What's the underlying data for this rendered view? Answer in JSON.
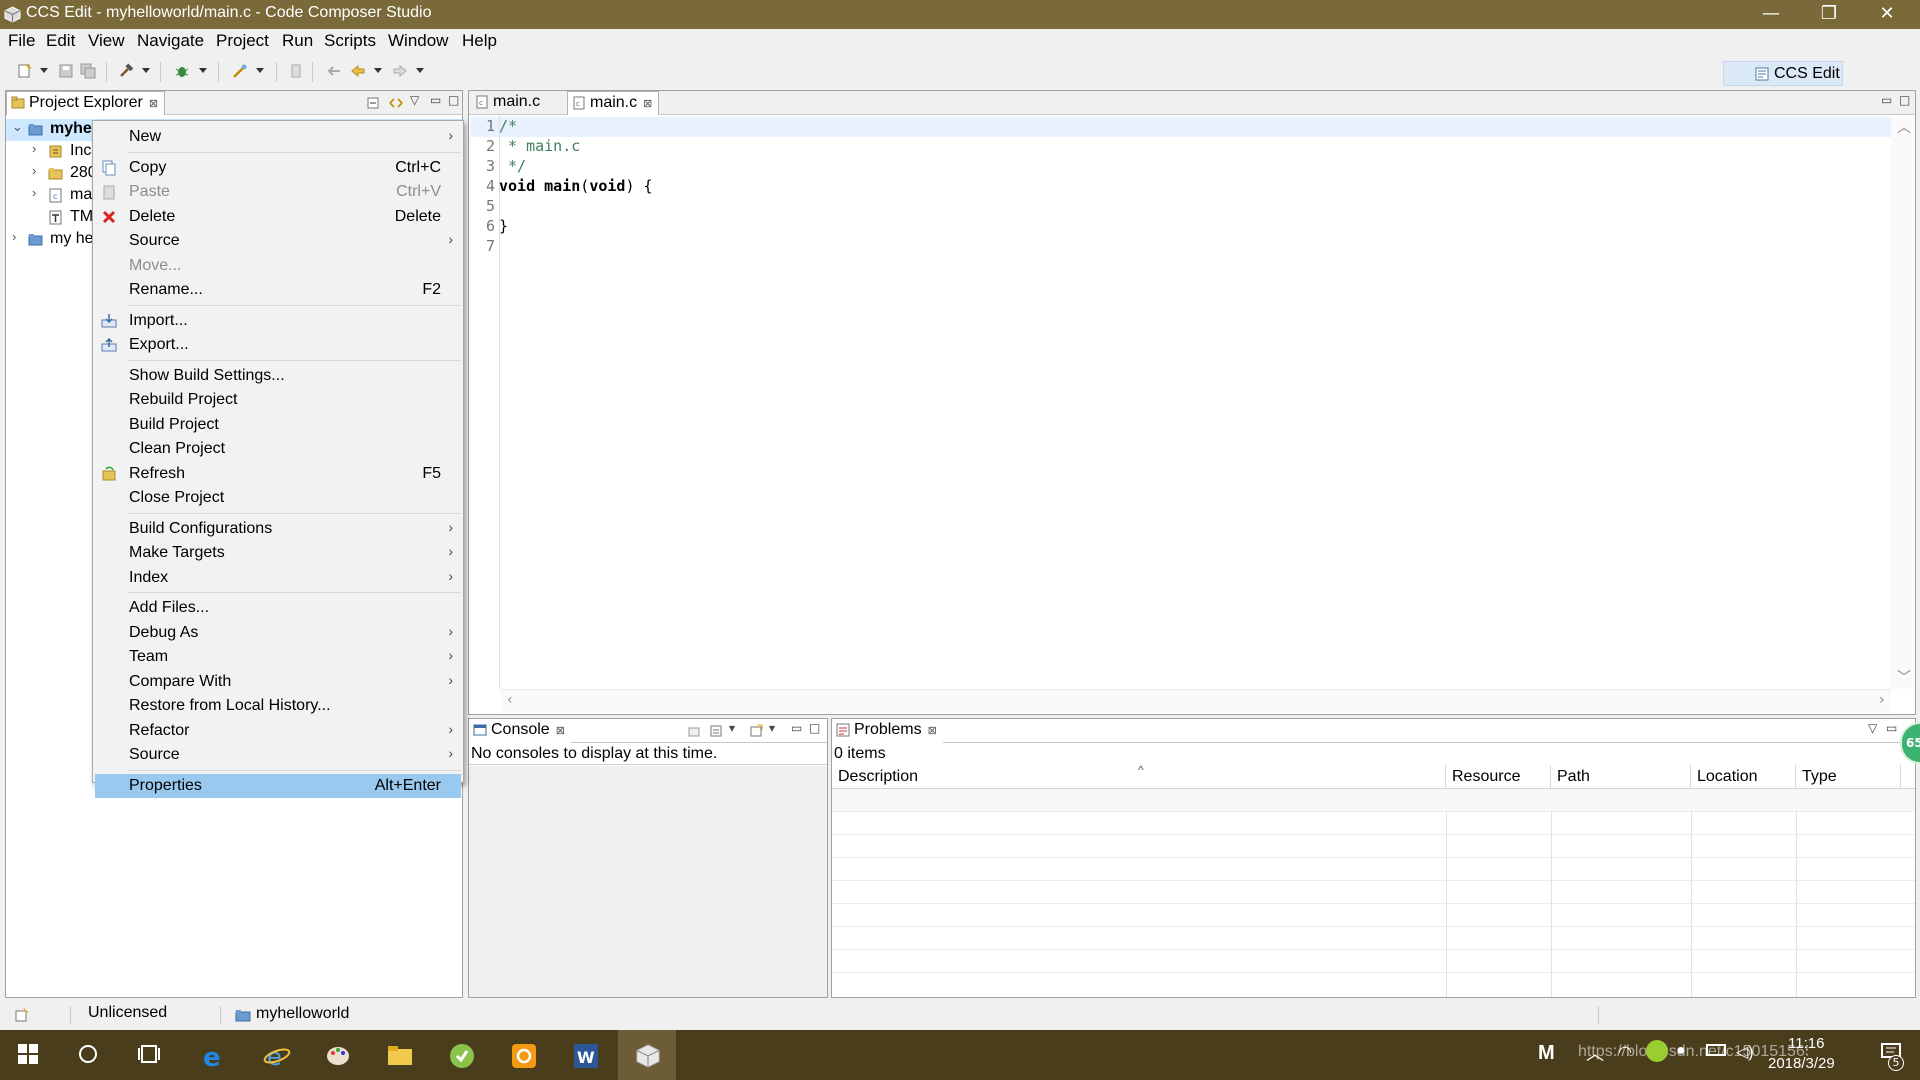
{
  "window": {
    "title": "CCS Edit - myhelloworld/main.c - Code Composer Studio",
    "minimize": "—",
    "restore": "❐",
    "close": "✕"
  },
  "menu": [
    "File",
    "Edit",
    "View",
    "Navigate",
    "Project",
    "Run",
    "Scripts",
    "Window",
    "Help"
  ],
  "perspective": {
    "label": "CCS Edit"
  },
  "project_explorer": {
    "tab_label": "Project Explorer",
    "tree": [
      {
        "label": "myhel",
        "expanded": true,
        "bold": true
      },
      {
        "label": "Inc"
      },
      {
        "label": "280"
      },
      {
        "label": "ma"
      },
      {
        "label": "TM"
      },
      {
        "label": "my he"
      }
    ]
  },
  "editor": {
    "tabs": [
      {
        "label": "main.c",
        "active": false
      },
      {
        "label": "main.c",
        "active": true
      }
    ],
    "lines": [
      {
        "num": "1",
        "text": "/*"
      },
      {
        "num": "2",
        "text": " * main.c"
      },
      {
        "num": "3",
        "text": " */"
      },
      {
        "num": "4",
        "text": "void main(void) {"
      },
      {
        "num": "5",
        "text": ""
      },
      {
        "num": "6",
        "text": "}"
      },
      {
        "num": "7",
        "text": ""
      }
    ]
  },
  "context_menu": [
    {
      "label": "New",
      "submenu": true
    },
    {
      "sep": true
    },
    {
      "label": "Copy",
      "shortcut": "Ctrl+C",
      "icon": "copy-icon"
    },
    {
      "label": "Paste",
      "shortcut": "Ctrl+V",
      "icon": "paste-icon",
      "disabled": true
    },
    {
      "label": "Delete",
      "shortcut": "Delete",
      "icon": "delete-icon"
    },
    {
      "label": "Source",
      "submenu": true
    },
    {
      "label": "Move...",
      "disabled": true
    },
    {
      "label": "Rename...",
      "shortcut": "F2"
    },
    {
      "sep": true
    },
    {
      "label": "Import...",
      "icon": "import-icon"
    },
    {
      "label": "Export...",
      "icon": "export-icon"
    },
    {
      "sep": true
    },
    {
      "label": "Show Build Settings..."
    },
    {
      "label": "Rebuild Project"
    },
    {
      "label": "Build Project"
    },
    {
      "label": "Clean Project"
    },
    {
      "label": "Refresh",
      "shortcut": "F5",
      "icon": "refresh-icon"
    },
    {
      "label": "Close Project"
    },
    {
      "sep": true
    },
    {
      "label": "Build Configurations",
      "submenu": true
    },
    {
      "label": "Make Targets",
      "submenu": true
    },
    {
      "label": "Index",
      "submenu": true
    },
    {
      "sep": true
    },
    {
      "label": "Add Files..."
    },
    {
      "label": "Debug As",
      "submenu": true
    },
    {
      "label": "Team",
      "submenu": true
    },
    {
      "label": "Compare With",
      "submenu": true
    },
    {
      "label": "Restore from Local History..."
    },
    {
      "label": "Refactor",
      "submenu": true
    },
    {
      "label": "Source",
      "submenu": true
    },
    {
      "sep": true
    },
    {
      "label": "Properties",
      "shortcut": "Alt+Enter",
      "selected": true
    }
  ],
  "console": {
    "tab_label": "Console",
    "message": "No consoles to display at this time."
  },
  "problems": {
    "tab_label": "Problems",
    "count": "0 items",
    "columns": [
      "Description",
      "Resource",
      "Path",
      "Location",
      "Type"
    ],
    "sort_indicator": "^"
  },
  "status": {
    "license": "Unlicensed",
    "project": "myhelloworld"
  },
  "taskbar": {
    "time": "11:16",
    "date": "2018/3/29",
    "watermark": "https://blog.csdn.net/c1501515652",
    "badge": "65",
    "notif": "5"
  },
  "colors": {
    "titlebar": "#7a6a39",
    "taskbar": "#4a3d1c",
    "selection": "#99c9ef",
    "comment": "#3f7f5f"
  }
}
